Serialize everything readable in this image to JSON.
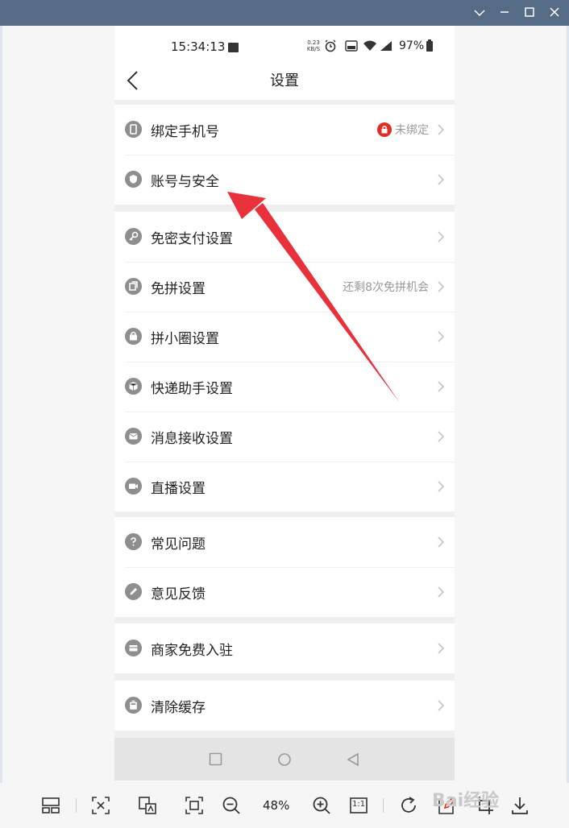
{
  "window": {
    "controls": [
      "chevron-down",
      "minimize",
      "maximize",
      "close"
    ]
  },
  "status_bar": {
    "time": "15:34:13",
    "net_speed_value": "0.23",
    "net_speed_unit": "KB/S",
    "battery": "97%"
  },
  "nav": {
    "title": "设置",
    "back_icon": "chevron-left-icon"
  },
  "groups": [
    {
      "items": [
        {
          "label": "绑定手机号",
          "icon": "phone-icon",
          "value": "未绑定",
          "value_icon": "lock-icon"
        },
        {
          "label": "账号与安全",
          "icon": "shield-icon",
          "value": ""
        }
      ]
    },
    {
      "items": [
        {
          "label": "免密支付设置",
          "icon": "key-icon",
          "value": ""
        },
        {
          "label": "免拼设置",
          "icon": "copy-icon",
          "value": "还剩8次免拼机会"
        },
        {
          "label": "拼小圈设置",
          "icon": "bag-icon",
          "value": ""
        },
        {
          "label": "快递助手设置",
          "icon": "box-icon",
          "value": ""
        },
        {
          "label": "消息接收设置",
          "icon": "mail-icon",
          "value": ""
        },
        {
          "label": "直播设置",
          "icon": "video-icon",
          "value": ""
        }
      ]
    },
    {
      "items": [
        {
          "label": "常见问题",
          "icon": "help-icon",
          "value": ""
        },
        {
          "label": "意见反馈",
          "icon": "edit-icon",
          "value": ""
        }
      ]
    },
    {
      "items": [
        {
          "label": "商家免费入驻",
          "icon": "store-icon",
          "value": ""
        }
      ]
    },
    {
      "items": [
        {
          "label": "清除缓存",
          "icon": "trash-icon",
          "value": ""
        }
      ]
    }
  ],
  "toolbar": {
    "zoom": "48%",
    "actual_size": "1:1",
    "watermark": "Bai经验"
  },
  "colors": {
    "titlebar": "#566b85",
    "accent_red": "#e02e24",
    "annotation_arrow": "#e8313a"
  }
}
